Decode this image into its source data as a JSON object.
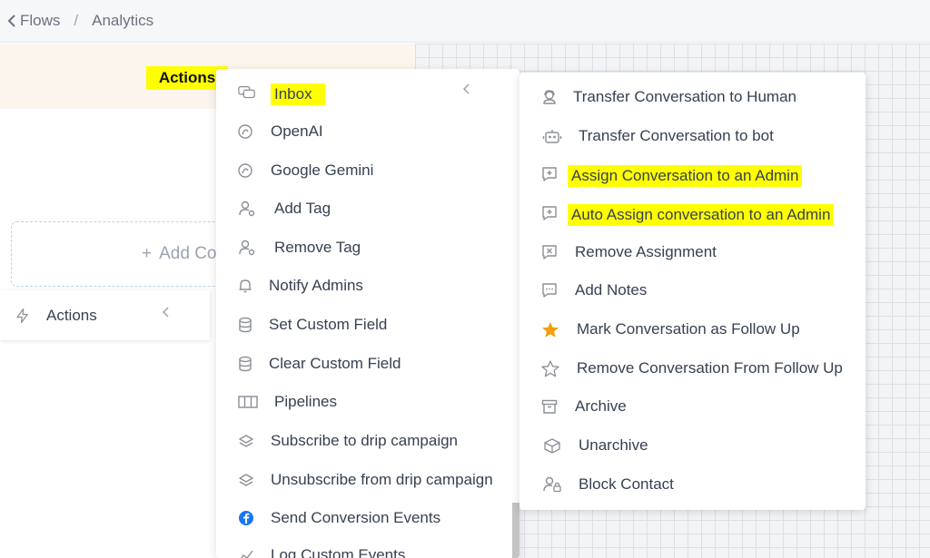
{
  "breadcrumb": {
    "back_label": "Flows",
    "separator": "/",
    "current": "Analytics"
  },
  "node": {
    "actions_label": "Actions"
  },
  "add_box": {
    "label": "Add Co"
  },
  "side_item": {
    "label": "Actions"
  },
  "menu1": {
    "items": [
      {
        "label": "Inbox",
        "icon": "chat-bubbles-icon",
        "highlighted": true
      },
      {
        "label": "OpenAI",
        "icon": "openai-icon"
      },
      {
        "label": "Google Gemini",
        "icon": "gemini-icon"
      },
      {
        "label": "Add Tag",
        "icon": "user-tag-icon"
      },
      {
        "label": "Remove Tag",
        "icon": "user-tag-icon"
      },
      {
        "label": "Notify Admins",
        "icon": "bell-icon"
      },
      {
        "label": "Set Custom Field",
        "icon": "database-icon"
      },
      {
        "label": "Clear Custom Field",
        "icon": "database-icon"
      },
      {
        "label": "Pipelines",
        "icon": "columns-icon"
      },
      {
        "label": "Subscribe to drip campaign",
        "icon": "layers-icon"
      },
      {
        "label": "Unsubscribe from drip campaign",
        "icon": "layers-icon"
      },
      {
        "label": "Send Conversion Events",
        "icon": "facebook-icon"
      },
      {
        "label": "Log Custom Events",
        "icon": "chart-icon"
      }
    ]
  },
  "menu2": {
    "items": [
      {
        "label": "Transfer Conversation to Human",
        "icon": "human-icon"
      },
      {
        "label": "Transfer Conversation to bot",
        "icon": "bot-icon"
      },
      {
        "label": "Assign Conversation to an Admin",
        "icon": "chat-plus-icon",
        "highlighted": true
      },
      {
        "label": "Auto Assign conversation to an Admin",
        "icon": "chat-plus-icon",
        "highlighted": true
      },
      {
        "label": "Remove Assignment",
        "icon": "chat-x-icon"
      },
      {
        "label": "Add Notes",
        "icon": "chat-dots-icon"
      },
      {
        "label": "Mark Conversation as Follow Up",
        "icon": "star-filled-icon"
      },
      {
        "label": "Remove Conversation From Follow Up",
        "icon": "star-outline-icon"
      },
      {
        "label": "Archive",
        "icon": "archive-icon"
      },
      {
        "label": "Unarchive",
        "icon": "unarchive-icon"
      },
      {
        "label": "Block Contact",
        "icon": "user-lock-icon"
      }
    ]
  },
  "colors": {
    "highlight": "#ffff00",
    "star": "#f59e0b",
    "facebook": "#1877f2"
  }
}
